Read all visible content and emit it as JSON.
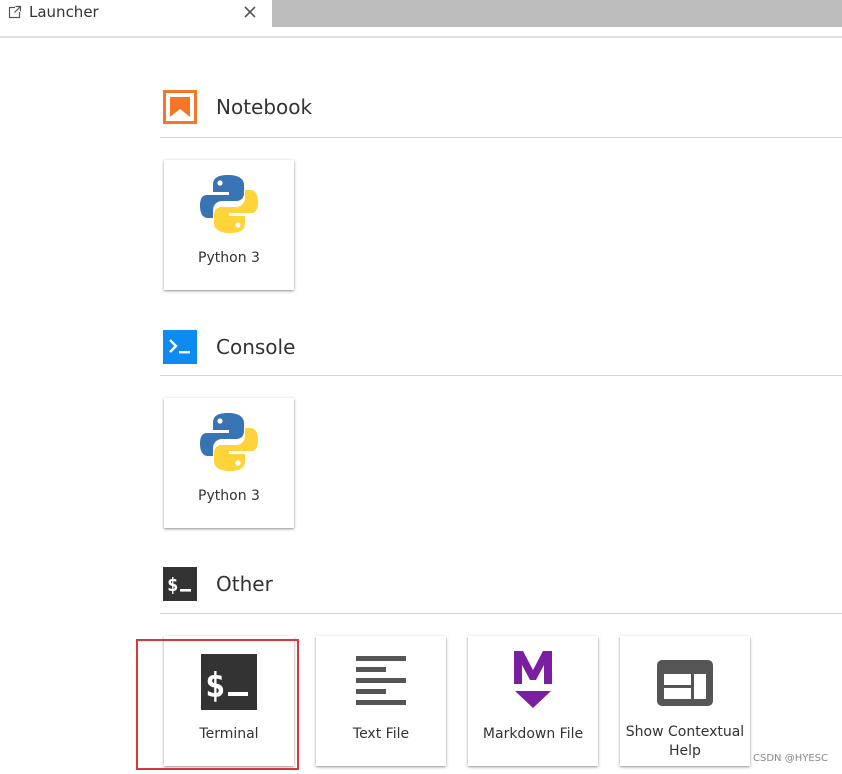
{
  "tab": {
    "title": "Launcher",
    "launch_icon": "launch-icon",
    "close_icon": "close-icon"
  },
  "sections": {
    "notebook": {
      "title": "Notebook",
      "icon": "notebook-icon",
      "icon_color": "#f37726",
      "cards": [
        {
          "label": "Python 3",
          "icon": "python-logo-icon"
        }
      ]
    },
    "console": {
      "title": "Console",
      "icon": "console-icon",
      "icon_color": "#0d8bf0",
      "cards": [
        {
          "label": "Python 3",
          "icon": "python-logo-icon"
        }
      ]
    },
    "other": {
      "title": "Other",
      "icon": "terminal-icon",
      "icon_color": "#333333",
      "cards": [
        {
          "label": "Terminal",
          "icon": "terminal-icon"
        },
        {
          "label": "Text File",
          "icon": "text-file-icon"
        },
        {
          "label": "Markdown File",
          "icon": "markdown-icon"
        },
        {
          "label": "Show Contextual Help",
          "icon": "contextual-help-icon"
        }
      ]
    }
  },
  "colors": {
    "notebook_orange": "#f37726",
    "console_blue": "#0d8bf0",
    "markdown_purple": "#7b1fa2",
    "highlight_red": "#d9363e",
    "tab_bar_gray": "#bdbdbd"
  },
  "watermark": "CSDN @HYESC"
}
